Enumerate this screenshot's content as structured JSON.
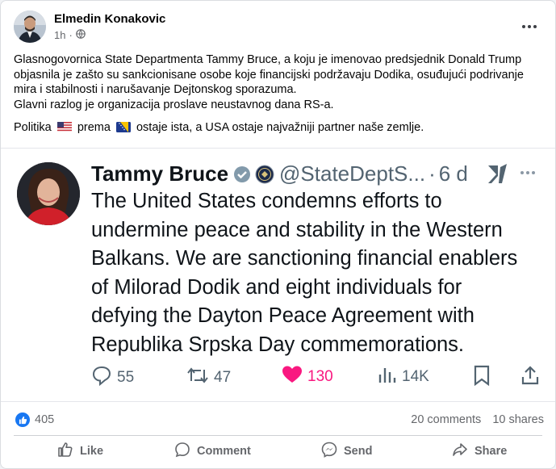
{
  "post": {
    "author": "Elmedin Konakovic",
    "time": "1h",
    "audience_icon": "globe-icon",
    "text_para1": [
      "Glasnogovornica State Departmenta Tammy Bruce, a koju je imenovao predsjednik Donald Trump",
      "objasnila je zašto su sankcionisane osobe koje financijski podržavaju Dodika, osuđujući podrivanje",
      "mira i stabilnosti i narušavanje Dejtonskog sporazuma.",
      "Glavni razlog je organizacija proslave neustavnog dana RS-a."
    ],
    "text_para2_a": "Politika",
    "text_para2_b": "prema",
    "text_para2_c": "ostaje ista, a USA ostaje najvažniji partner naše zemlje.",
    "flag1": "us-flag-icon",
    "flag2": "bosnia-flag-icon"
  },
  "tweet": {
    "name": "Tammy Bruce",
    "handle": "@StateDeptS...",
    "sep": "·",
    "age": "6 d",
    "body": [
      "The United States condemns efforts to",
      "undermine peace and stability in the Western",
      "Balkans. We are sanctioning financial enablers",
      "of Milorad Dodik and eight individuals for",
      "defying the Dayton Peace Agreement with",
      "Republika Srpska Day commemorations."
    ],
    "replies": "55",
    "reposts": "47",
    "likes": "130",
    "views": "14K",
    "colors": {
      "like": "#f91880",
      "verified": "#829aab"
    }
  },
  "stats": {
    "reactions": "405",
    "comments": "20 comments",
    "shares": "10 shares"
  },
  "actions": {
    "like": "Like",
    "comment": "Comment",
    "send": "Send",
    "share": "Share"
  }
}
